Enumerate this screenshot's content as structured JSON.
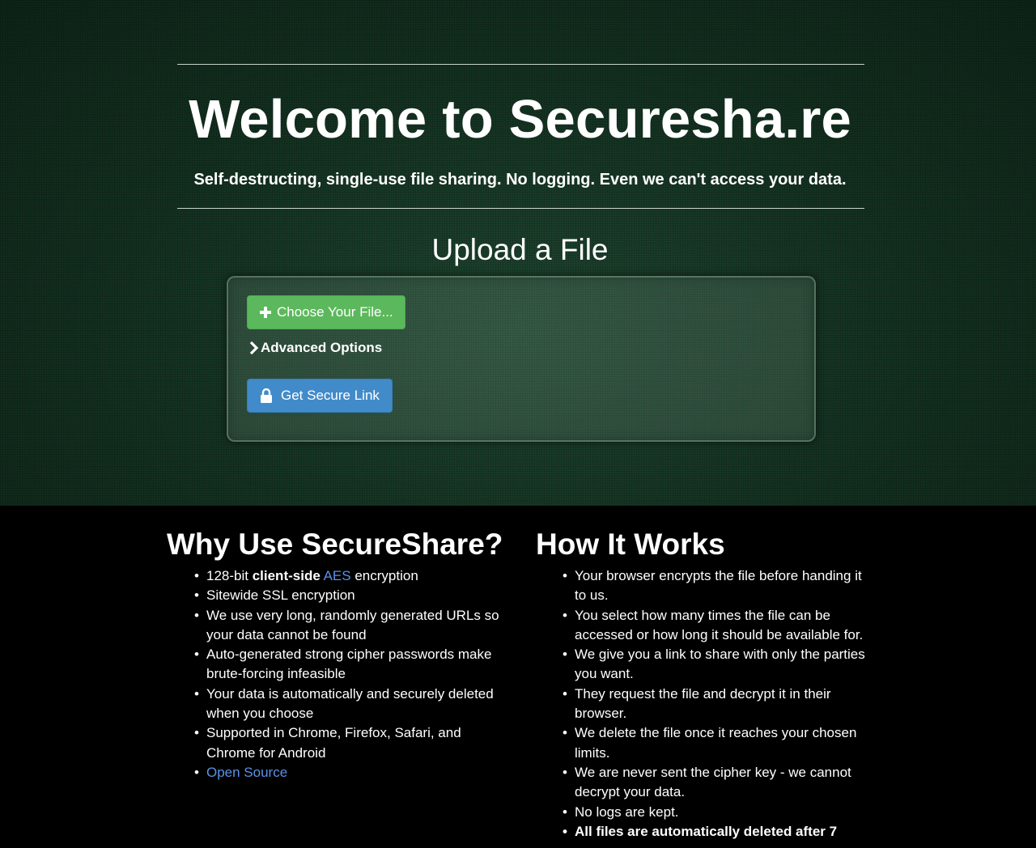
{
  "hero": {
    "title": "Welcome to Securesha.re",
    "subtitle": "Self-destructing, single-use file sharing. No logging. Even we can't access your data."
  },
  "upload": {
    "title": "Upload a File",
    "choose_icon": "plus-icon",
    "choose_label": "Choose Your File...",
    "advanced_icon": "chevron-right-icon",
    "advanced_label": "Advanced Options",
    "link_icon": "lock-icon",
    "link_label": "Get Secure Link"
  },
  "why": {
    "title": "Why Use SecureShare?",
    "items": {
      "aes": {
        "prefix": "128-bit ",
        "bold": "client-side",
        "link": "AES",
        "suffix": " encryption"
      },
      "ssl": "Sitewide SSL encryption",
      "urls": "We use very long, randomly generated URLs so your data cannot be found",
      "passwords": "Auto-generated strong cipher passwords make brute-forcing infeasible",
      "deleted": "Your data is automatically and securely deleted when you choose",
      "browsers": "Supported in Chrome, Firefox, Safari, and Chrome for Android",
      "open_source": "Open Source"
    }
  },
  "how": {
    "title": "How It Works",
    "items": [
      "Your browser encrypts the file before handing it to us.",
      "You select how many times the file can be accessed or how long it should be available for.",
      "We give you a link to share with only the parties you want.",
      "They request the file and decrypt it in their browser.",
      "We delete the file once it reaches your chosen limits.",
      "We are never sent the cipher key - we cannot decrypt your data.",
      "No logs are kept.",
      "All files are automatically deleted after 7"
    ]
  },
  "colors": {
    "hero_bg": "#14301f",
    "choose_button": "#5cb85c",
    "link_button": "#428bca",
    "link_text": "#5b92e5"
  }
}
